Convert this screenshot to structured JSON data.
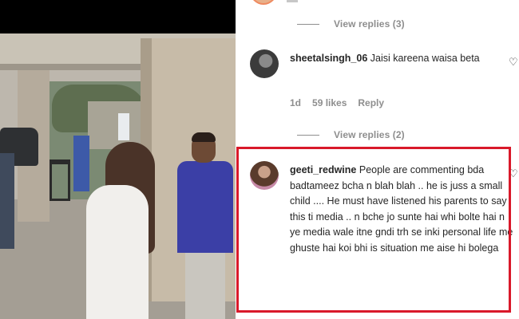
{
  "video": {
    "description": ""
  },
  "comments_panel": {
    "view_replies_top": "View replies (3)",
    "comments": [
      {
        "username": "sheetalsingh_06",
        "text": "Jaisi kareena waisa beta",
        "age": "1d",
        "likes": "59 likes",
        "reply_label": "Reply",
        "view_replies": "View replies (2)"
      },
      {
        "username": "geeti_redwine",
        "text": "People are commenting bda badtameez bcha n blah blah .. he is juss a small child .... He must have listened his parents to say this ti media .. n bche jo sunte hai whi bolte hai n ye media wale itne gndi trh se inki personal life me ghuste hai koi bhi is situation me aise hi bolega"
      }
    ],
    "heart_icon": "heart-outline-icon"
  },
  "colors": {
    "highlight_border": "#d9192a",
    "secondary_text": "#8e8e8e",
    "primary_text": "#262626"
  }
}
